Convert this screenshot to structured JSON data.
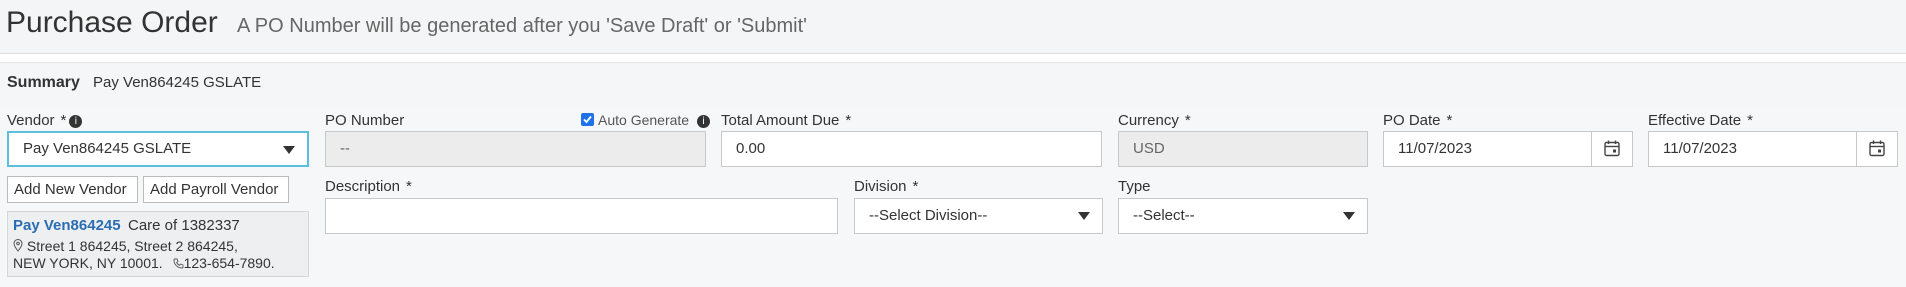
{
  "header": {
    "title": "Purchase Order",
    "subtitle": "A PO Number will be generated after you 'Save Draft' or 'Submit'"
  },
  "summary": {
    "label": "Summary",
    "value": "Pay Ven864245 GSLATE"
  },
  "form": {
    "vendor": {
      "label": "Vendor",
      "required": "*",
      "value": "Pay Ven864245 GSLATE"
    },
    "po_number": {
      "label": "PO Number",
      "value": "--",
      "auto_generate_label": "Auto Generate",
      "auto_generate_checked": true
    },
    "total_amount_due": {
      "label": "Total Amount Due",
      "required": "*",
      "value": "0.00"
    },
    "currency": {
      "label": "Currency",
      "required": "*",
      "value": "USD"
    },
    "po_date": {
      "label": "PO Date",
      "required": "*",
      "value": "11/07/2023"
    },
    "effective_date": {
      "label": "Effective Date",
      "required": "*",
      "value": "11/07/2023"
    },
    "description": {
      "label": "Description",
      "required": "*",
      "value": ""
    },
    "division": {
      "label": "Division",
      "required": "*",
      "value": "--Select Division--"
    },
    "type": {
      "label": "Type",
      "value": "--Select--"
    }
  },
  "buttons": {
    "add_new_vendor": "Add New Vendor",
    "add_payroll_vendor": "Add Payroll Vendor"
  },
  "vendor_card": {
    "name": "Pay Ven864245",
    "care_of": "Care of 1382337",
    "address_line1": "Street 1 864245,  Street 2 864245,",
    "address_line2": "NEW YORK,  NY  10001.",
    "phone": "123-654-7890."
  },
  "colors": {
    "link": "#2a6db3",
    "focus_border": "#5bc0de",
    "checkbox": "#1e73e8"
  },
  "icons": [
    "info-icon",
    "calendar-icon",
    "caret-down-icon",
    "map-pin-icon",
    "phone-icon",
    "checkbox-icon"
  ]
}
